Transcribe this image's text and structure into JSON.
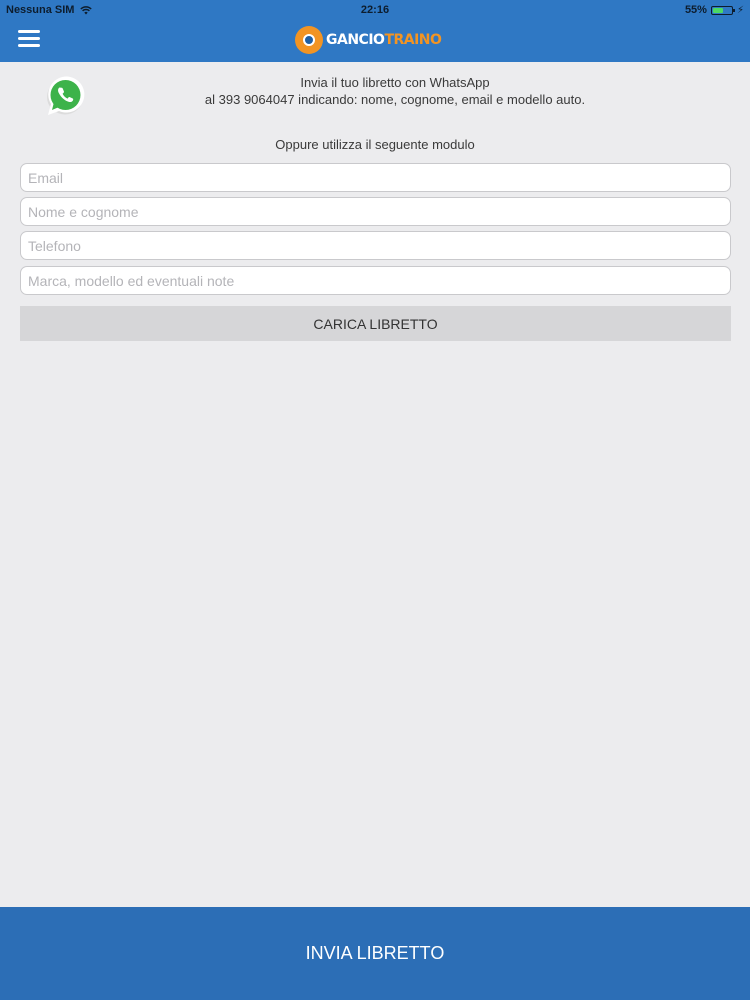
{
  "status_bar": {
    "carrier": "Nessuna SIM",
    "time": "22:16",
    "battery_percent": "55%",
    "battery_level": 0.55,
    "wifi_icon": "wifi-icon",
    "charging_icon": "bolt-icon"
  },
  "nav": {
    "menu_icon": "hamburger-menu-icon",
    "logo_part1": "GANCIO",
    "logo_part2": "TRAINO",
    "accent_color": "#f29423",
    "bar_color": "#2f78c4"
  },
  "whatsapp": {
    "icon": "whatsapp-icon",
    "line1": "Invia il tuo libretto con WhatsApp",
    "line2": "al 393 9064047 indicando: nome, cognome, email e modello auto."
  },
  "form": {
    "heading": "Oppure utilizza il seguente modulo",
    "email_placeholder": "Email",
    "name_placeholder": "Nome e cognome",
    "phone_placeholder": "Telefono",
    "notes_placeholder": "Marca, modello ed eventuali note",
    "upload_label": "CARICA LIBRETTO"
  },
  "footer": {
    "submit_label": "INVIA LIBRETTO",
    "bar_color": "#2c6eb6"
  }
}
